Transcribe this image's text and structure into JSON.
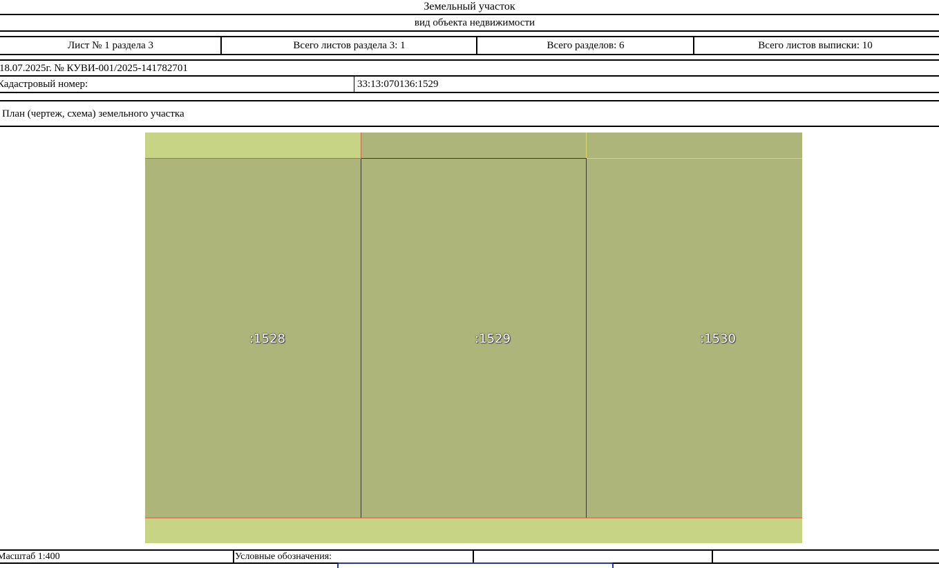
{
  "header": {
    "object_type": "Земельный участок",
    "object_type_caption": "вид объекта недвижимости"
  },
  "sheet_info": {
    "sheet": "Лист № 1 раздела 3",
    "sheets_in_section": "Всего листов раздела 3: 1",
    "sections_total": "Всего разделов: 6",
    "sheets_total": "Всего листов выписки: 10"
  },
  "statement": {
    "date_number": "18.07.2025г. № КУВИ-001/2025-141782701"
  },
  "cadastral": {
    "label": "Кадастровый номер:",
    "value": "33:13:070136:1529"
  },
  "plan": {
    "title": "План (чертеж, схема) земельного участка",
    "parcels": [
      {
        "label": ":1528",
        "selected": false
      },
      {
        "label": ":1529",
        "selected": true
      },
      {
        "label": ":1530",
        "selected": false
      }
    ],
    "colors": {
      "background": "#c8d485",
      "parcel_fill": "#adb57b",
      "boundary": "#c0694b",
      "selected_outline": "#3a3a2a"
    }
  },
  "footer": {
    "scale": "Масштаб 1:400",
    "legend_label": "Условные обозначения:"
  }
}
